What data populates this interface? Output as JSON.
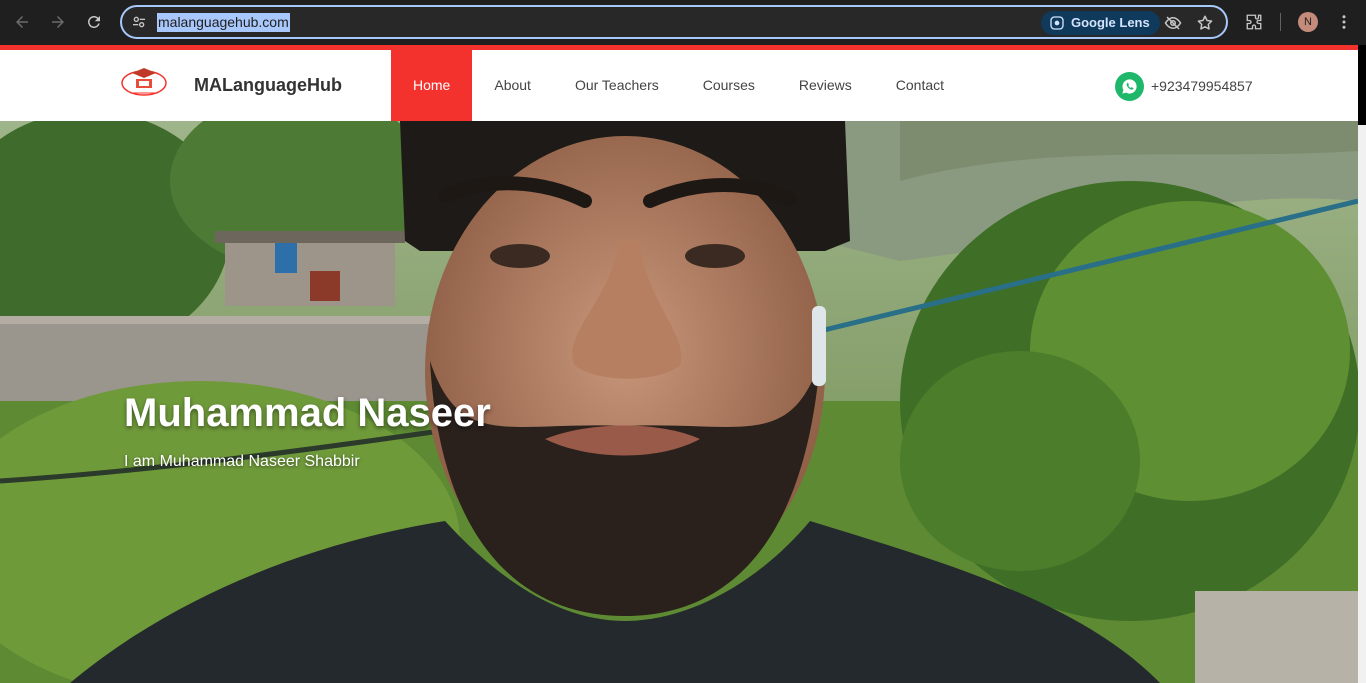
{
  "browser": {
    "url": "malanguagehub.com",
    "lens_label": "Google Lens",
    "profile_initial": "N"
  },
  "site": {
    "brand": "MALanguageHub",
    "menu": [
      {
        "label": "Home",
        "active": true
      },
      {
        "label": "About",
        "active": false
      },
      {
        "label": "Our Teachers",
        "active": false
      },
      {
        "label": "Courses",
        "active": false
      },
      {
        "label": "Reviews",
        "active": false
      },
      {
        "label": "Contact",
        "active": false
      }
    ],
    "phone": "+923479954857"
  },
  "hero": {
    "title": "Muhammad Naseer",
    "subtitle": "I am Muhammad Naseer Shabbir"
  },
  "colors": {
    "accent": "#f4322d",
    "whatsapp": "#1fb86b",
    "chrome_bg": "#1f1f1f",
    "omnibox_border": "#a8c7fa"
  }
}
